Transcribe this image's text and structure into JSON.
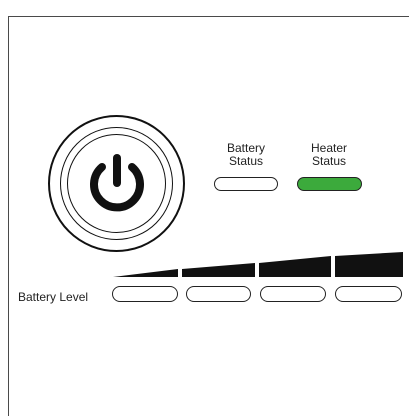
{
  "panel": {
    "power_button": {
      "icon": "power-icon"
    },
    "battery_status": {
      "label_line1": "Battery",
      "label_line2": "Status",
      "state": "off",
      "color": "#ffffff"
    },
    "heater_status": {
      "label_line1": "Heater",
      "label_line2": "Status",
      "state": "on",
      "color": "#3caa3c"
    },
    "battery_level": {
      "label": "Battery Level",
      "segments": 4,
      "indicators_lit": 0
    }
  },
  "colors": {
    "border": "#222222",
    "led_green": "#3caa3c"
  }
}
